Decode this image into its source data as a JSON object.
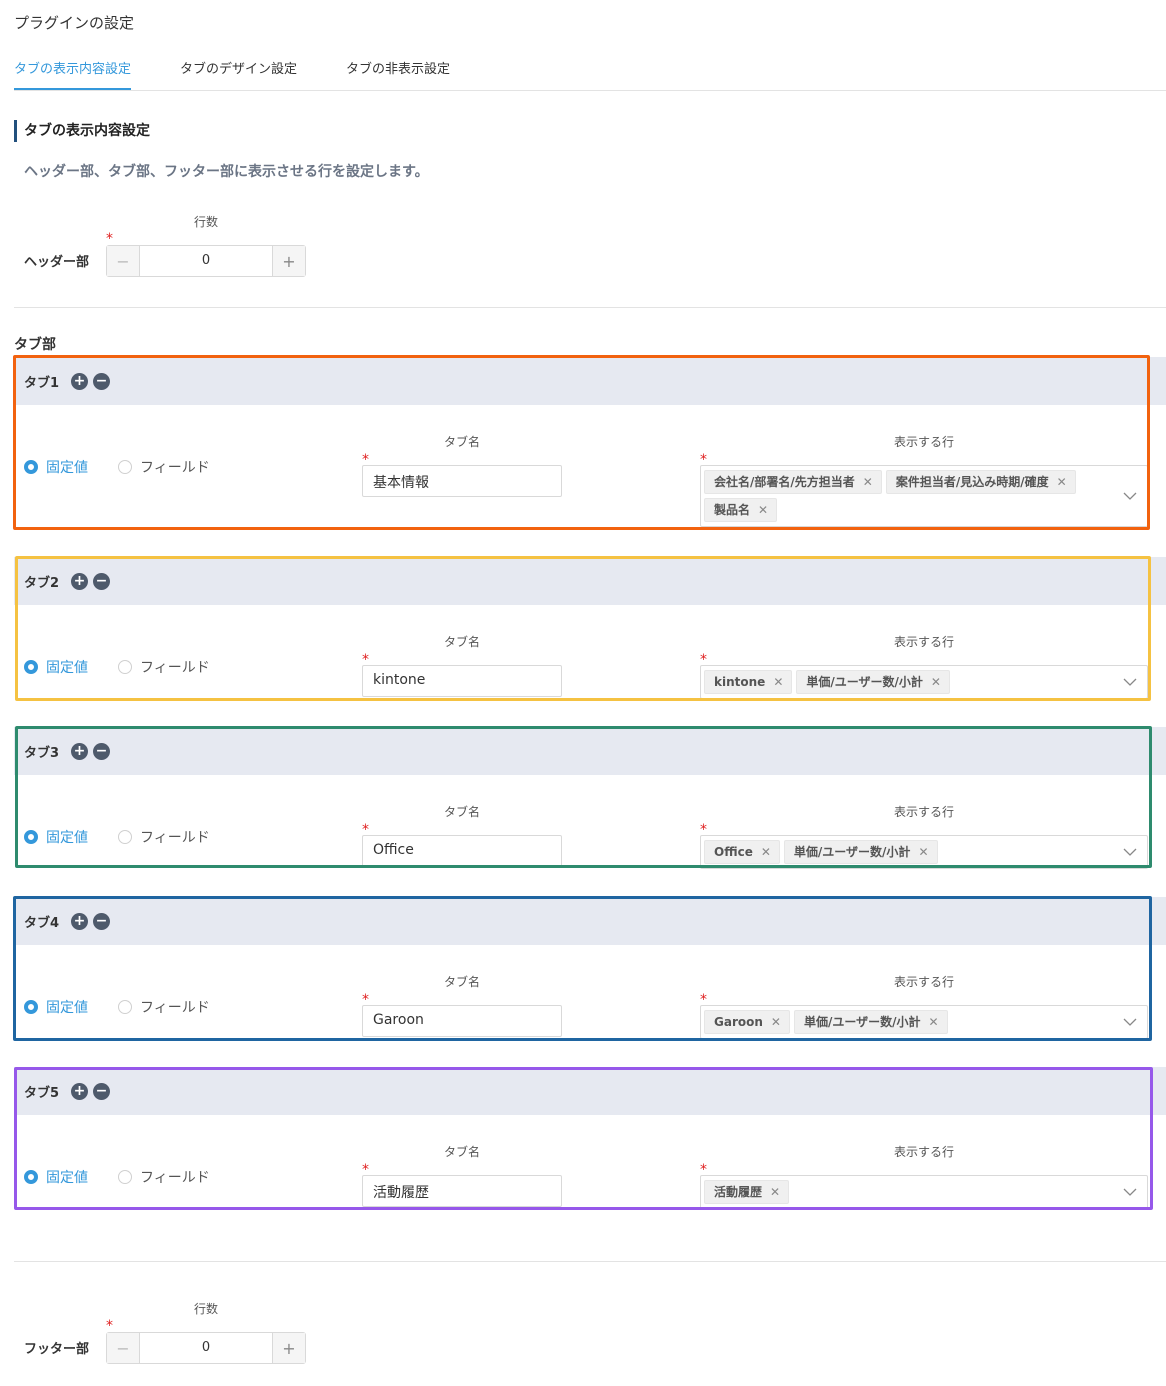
{
  "page": {
    "title": "プラグインの設定"
  },
  "tabs": [
    {
      "label": "タブの表示内容設定",
      "active": true
    },
    {
      "label": "タブのデザイン設定",
      "active": false
    },
    {
      "label": "タブの非表示設定",
      "active": false
    }
  ],
  "section": {
    "title": "タブの表示内容設定",
    "description": "ヘッダー部、タブ部、フッター部に表示させる行を設定します。"
  },
  "header_part": {
    "label": "ヘッダー部",
    "count_label": "行数",
    "value": "0",
    "required_mark": "*"
  },
  "tab_part": {
    "title": "タブ部",
    "name_label": "タブ名",
    "rows_label": "表示する行",
    "radio_fixed": "固定値",
    "radio_field": "フィールド",
    "required_mark": "*",
    "add_icon": "plus-circle-icon",
    "remove_icon": "minus-circle-icon",
    "cards": [
      {
        "title": "タブ1",
        "tab_name": "基本情報",
        "tags": [
          "会社名/部署名/先方担当者",
          "案件担当者/見込み時期/確度",
          "製品名"
        ],
        "frame_color": "#f2620f"
      },
      {
        "title": "タブ2",
        "tab_name": "kintone",
        "tags": [
          "kintone",
          "単価/ユーザー数/小計"
        ],
        "frame_color": "#f5c242"
      },
      {
        "title": "タブ3",
        "tab_name": "Office",
        "tags": [
          "Office",
          "単価/ユーザー数/小計"
        ],
        "frame_color": "#2e8b6e"
      },
      {
        "title": "タブ4",
        "tab_name": "Garoon",
        "tags": [
          "Garoon",
          "単価/ユーザー数/小計"
        ],
        "frame_color": "#1f65a1"
      },
      {
        "title": "タブ5",
        "tab_name": "活動履歴",
        "tags": [
          "活動履歴"
        ],
        "frame_color": "#9658ea"
      }
    ]
  },
  "footer_part": {
    "label": "フッター部",
    "count_label": "行数",
    "value": "0",
    "required_mark": "*"
  },
  "colors": {
    "accent": "#3498db",
    "required": "#e02020",
    "card_header": "#e6e9f1",
    "section_bar": "#22507d"
  }
}
